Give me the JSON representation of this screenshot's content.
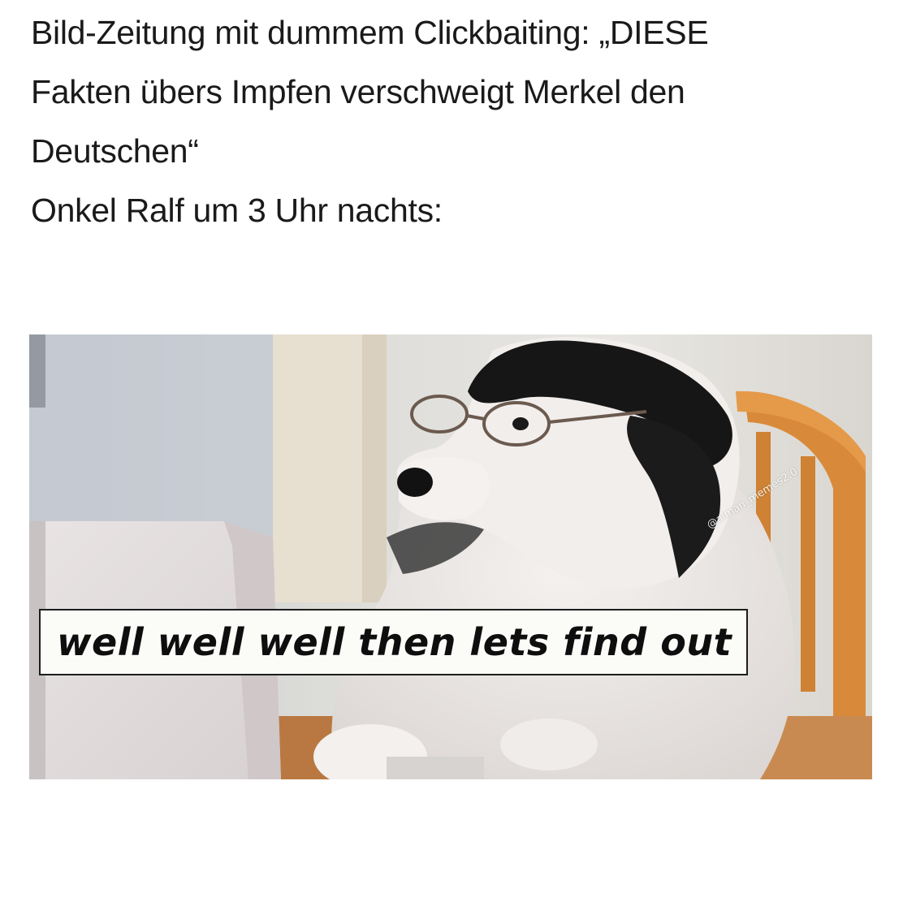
{
  "caption": {
    "lines": [
      "Bild-Zeitung mit dummem Clickbaiting: „DIESE",
      "Fakten übers Impfen verschweigt Merkel den",
      "Deutschen“",
      "Onkel Ralf um 3 Uhr nachts:"
    ]
  },
  "meme": {
    "subtitle": "well well well then lets find out",
    "watermark": "@alman_memes2.0"
  }
}
